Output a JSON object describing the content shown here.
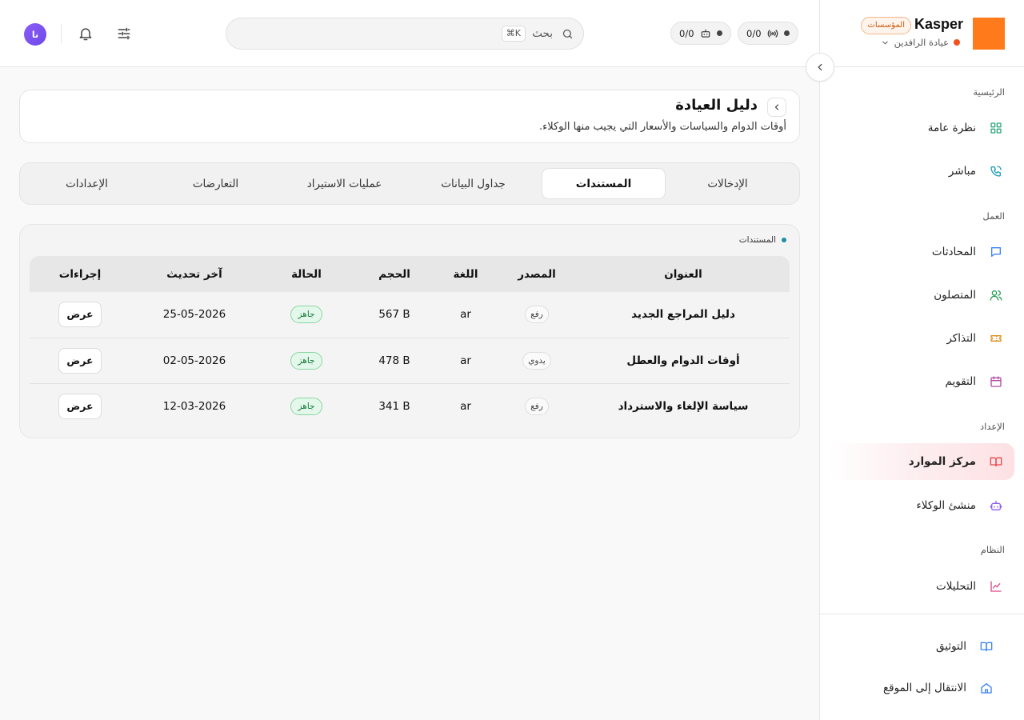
{
  "brand": {
    "name": "Kasper",
    "badge": "المؤسسات",
    "org_name": "عيادة الرافدين",
    "logo_color": "#fe7a1b"
  },
  "header": {
    "channel_counter": "0/0",
    "agent_counter": "0/0",
    "search_placeholder": "بحث",
    "search_shortcut": "⌘K",
    "avatar_initials": "نا"
  },
  "sidebar": {
    "sections": {
      "home": "الرئيسية",
      "work": "العمل",
      "setup": "الإعداد",
      "system": "النظام"
    },
    "items": [
      {
        "label": "نظرة عامة",
        "icon": "grid-icon",
        "color": "#2aa67a"
      },
      {
        "label": "مباشر",
        "icon": "phone-icon",
        "color": "#1f9fb8"
      },
      {
        "label": "المحادثات",
        "icon": "chat-icon",
        "color": "#3b82f6"
      },
      {
        "label": "المتصلون",
        "icon": "users-icon",
        "color": "#2a9d5a"
      },
      {
        "label": "التذاكر",
        "icon": "ticket-icon",
        "color": "#e38b17"
      },
      {
        "label": "التقويم",
        "icon": "calendar-icon",
        "color": "#b14aa6"
      },
      {
        "label": "مركز الموارد",
        "icon": "book-icon",
        "color": "#e5484d",
        "active": true
      },
      {
        "label": "منشئ الوكلاء",
        "icon": "bot-icon",
        "color": "#8b5cf6"
      },
      {
        "label": "التحليلات",
        "icon": "chart-icon",
        "color": "#d94a8c"
      }
    ],
    "footer": [
      {
        "label": "التوثيق",
        "icon": "book-open-icon",
        "color": "#3b82f6"
      },
      {
        "label": "الانتقال إلى الموقع",
        "icon": "home-icon",
        "color": "#3b82f6"
      }
    ]
  },
  "page": {
    "title": "دليل العيادة",
    "subtitle": "أوقات الدوام والسياسات والأسعار التي يجيب منها الوكلاء."
  },
  "tabs": [
    "الإدخالات",
    "المستندات",
    "جداول البيانات",
    "عمليات الاستيراد",
    "التعارضات",
    "الإعدادات"
  ],
  "active_tab": "المستندات",
  "documents": {
    "heading": "المستندات",
    "columns": [
      "العنوان",
      "المصدر",
      "اللغة",
      "الحجم",
      "الحالة",
      "آخر تحديث",
      "إجراءات"
    ],
    "rows": [
      {
        "title": "دليل المراجع الجديد",
        "source": "رفع",
        "language": "ar",
        "size": "567 B",
        "status": "جاهز",
        "updated": "25-05-2026",
        "action": "عرض"
      },
      {
        "title": "أوقات الدوام والعطل",
        "source": "يدوي",
        "language": "ar",
        "size": "478 B",
        "status": "جاهز",
        "updated": "02-05-2026",
        "action": "عرض"
      },
      {
        "title": "سياسة الإلغاء والاسترداد",
        "source": "رفع",
        "language": "ar",
        "size": "341 B",
        "status": "جاهز",
        "updated": "12-03-2026",
        "action": "عرض"
      }
    ]
  }
}
